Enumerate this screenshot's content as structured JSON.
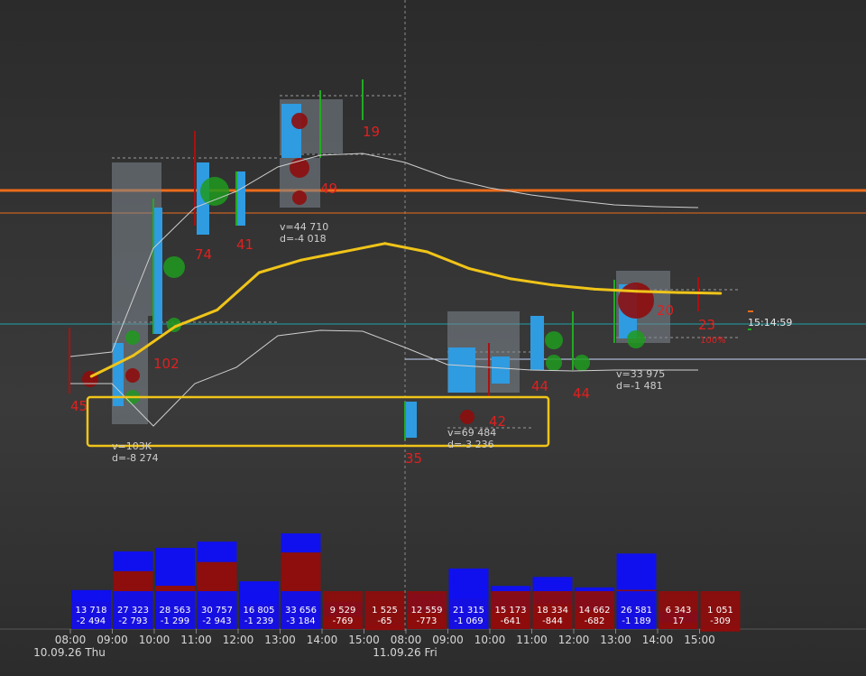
{
  "chart_data": {
    "type": "bar",
    "x_axis": {
      "times": [
        "08:00",
        "09:00",
        "10:00",
        "11:00",
        "12:00",
        "13:00",
        "14:00",
        "15:00",
        "08:00",
        "09:00",
        "10:00",
        "11:00",
        "12:00",
        "13:00",
        "14:00",
        "15:00"
      ],
      "dates": [
        "10.09.26 Thu",
        "11.09.26 Fri"
      ]
    },
    "volume_bars": [
      {
        "volume": "13 718",
        "delta": "-2 494",
        "vol": 13718,
        "del": -2494
      },
      {
        "volume": "27 323",
        "delta": "-2 793",
        "vol": 27323,
        "del": -2793
      },
      {
        "volume": "28 563",
        "delta": "-1 299",
        "vol": 28563,
        "del": -1299
      },
      {
        "volume": "30 757",
        "delta": "-2 943",
        "vol": 30757,
        "del": -2943
      },
      {
        "volume": "16 805",
        "delta": "-1 239",
        "vol": 16805,
        "del": -1239
      },
      {
        "volume": "33 656",
        "delta": "-3 184",
        "vol": 33656,
        "del": -3184
      },
      {
        "volume": "9 529",
        "delta": "-769",
        "vol": 9529,
        "del": -769
      },
      {
        "volume": "1 525",
        "delta": "-65",
        "vol": 1525,
        "del": -65
      },
      {
        "volume": "12 559",
        "delta": "-773",
        "vol": 12559,
        "del": -773
      },
      {
        "volume": "21 315",
        "delta": "-1 069",
        "vol": 21315,
        "del": -1069
      },
      {
        "volume": "15 173",
        "delta": "-641",
        "vol": 15173,
        "del": -641
      },
      {
        "volume": "18 334",
        "delta": "-844",
        "vol": 18334,
        "del": -844
      },
      {
        "volume": "14 662",
        "delta": "-682",
        "vol": 14662,
        "del": -682
      },
      {
        "volume": "26 581",
        "delta": "-1 189",
        "vol": 26581,
        "del": -1189
      },
      {
        "volume": "6 343",
        "delta": "17",
        "vol": 6343,
        "del": 17
      },
      {
        "volume": "1 051",
        "delta": "-309",
        "vol": 1051,
        "del": -309
      }
    ],
    "candle_labels": [
      "45",
      "102",
      "74",
      "41",
      "49",
      "19",
      "35",
      "42",
      "44",
      "44",
      "20",
      "23"
    ],
    "profile_stats": [
      {
        "v": "v=103K",
        "d": "d=-8 274"
      },
      {
        "v": "v=44 710",
        "d": "d=-4 018"
      },
      {
        "v": "v=69 484",
        "d": "d=-3 236"
      },
      {
        "v": "v=33 975",
        "d": "d=-1 481"
      }
    ],
    "vwap_line": [
      0.0,
      0.5,
      1.2,
      1.6,
      2.5,
      2.8,
      3.0,
      3.2,
      3.0,
      2.6,
      2.35,
      2.2,
      2.1,
      2.05,
      2.02,
      2.0
    ],
    "current_time": "15:14:59",
    "percent_label": "100%",
    "colors": {
      "buy": "#1010ee",
      "sell": "#8e0d0d",
      "vwap": "#f0c419",
      "level": "#ee6b1a",
      "bid": "#2f9be0",
      "ask": "#22aa22"
    }
  }
}
